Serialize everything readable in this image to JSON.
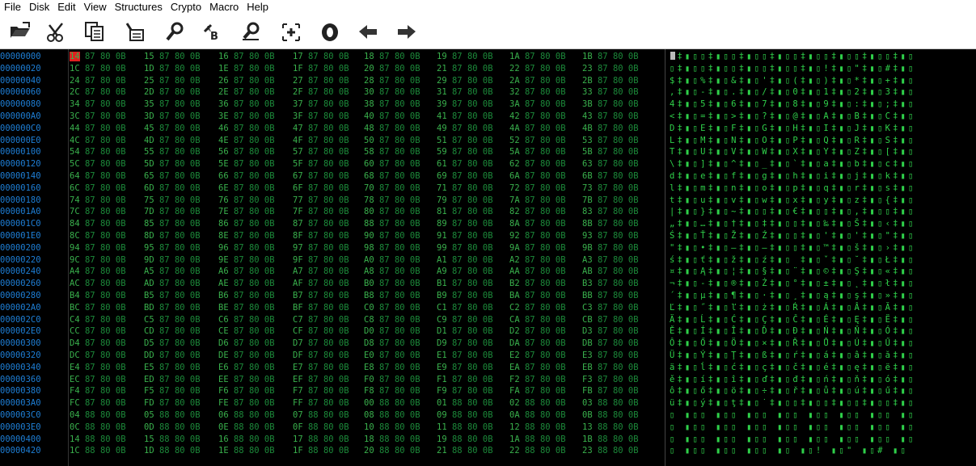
{
  "menu": [
    "File",
    "Disk",
    "Edit",
    "View",
    "Structures",
    "Crypto",
    "Macro",
    "Help"
  ],
  "toolbar": [
    {
      "name": "open-file-icon"
    },
    {
      "name": "cut-icon"
    },
    {
      "name": "copy-icon"
    },
    {
      "name": "paste-icon"
    },
    {
      "name": "search-icon"
    },
    {
      "name": "replace-icon"
    },
    {
      "name": "find-next-icon"
    },
    {
      "name": "goto-offset-icon"
    },
    {
      "name": "bookmark-icon"
    },
    {
      "name": "back-arrow-icon"
    },
    {
      "name": "forward-arrow-icon"
    }
  ],
  "hex": {
    "colors": {
      "address": "#1e7fd6",
      "hex": "#1c8a3a",
      "ascii": "#2fd04a",
      "selection": "#e02020"
    },
    "selected_byte": "14",
    "rows": [
      {
        "addr": "00000000",
        "ascii": "▯‡▮▯▯‡▮▯▯‡▮▯▯‡▮▯▯‡▮▯▯‡▮▯▯‡▮▯▯‡▮▯"
      },
      {
        "addr": "00000020",
        "ascii": "▯‡▮▯▯‡▮▯▯‡▮▯▯‡▮▯▯‡▮▯!‡▮▯\"‡▮▯#‡▮▯"
      },
      {
        "addr": "00000040",
        "ascii": "$‡▮▯%‡▮▯&‡▮▯'‡▮▯(‡▮▯)‡▮▯*‡▮▯+‡▮▯"
      },
      {
        "addr": "00000060",
        "ascii": ",‡▮▯-‡▮▯.‡▮▯/‡▮▯0‡▮▯1‡▮▯2‡▮▯3‡▮▯"
      },
      {
        "addr": "00000080",
        "ascii": "4‡▮▯5‡▮▯6‡▮▯7‡▮▯8‡▮▯9‡▮▯:‡▮▯;‡▮▯"
      },
      {
        "addr": "000000A0",
        "ascii": "<‡▮▯=‡▮▯>‡▮▯?‡▮▯@‡▮▯A‡▮▯B‡▮▯C‡▮▯"
      },
      {
        "addr": "000000C0",
        "ascii": "D‡▮▯E‡▮▯F‡▮▯G‡▮▯H‡▮▯I‡▮▯J‡▮▯K‡▮▯"
      },
      {
        "addr": "000000E0",
        "ascii": "L‡▮▯M‡▮▯N‡▮▯O‡▮▯P‡▮▯Q‡▮▯R‡▮▯S‡▮▯"
      },
      {
        "addr": "00000100",
        "ascii": "T‡▮▯U‡▮▯V‡▮▯W‡▮▯X‡▮▯Y‡▮▯Z‡▮▯[‡▮▯"
      },
      {
        "addr": "00000120",
        "ascii": "\\‡▮▯]‡▮▯^‡▮▯_‡▮▯`‡▮▯a‡▮▯b‡▮▯c‡▮▯"
      },
      {
        "addr": "00000140",
        "ascii": "d‡▮▯e‡▮▯f‡▮▯g‡▮▯h‡▮▯i‡▮▯j‡▮▯k‡▮▯"
      },
      {
        "addr": "00000160",
        "ascii": "l‡▮▯m‡▮▯n‡▮▯o‡▮▯p‡▮▯q‡▮▯r‡▮▯s‡▮▯"
      },
      {
        "addr": "00000180",
        "ascii": "t‡▮▯u‡▮▯v‡▮▯w‡▮▯x‡▮▯y‡▮▯z‡▮▯{‡▮▯"
      },
      {
        "addr": "000001A0",
        "ascii": "|‡▮▯}‡▮▯~‡▮▯▯‡▮▯€‡▮▯▯‡▮▯‚‡▮▯▯‡▮▯"
      },
      {
        "addr": "000001C0",
        "ascii": "„‡▮▯…‡▮▯†‡▮▯‡‡▮▯▯‡▮▯‰‡▮▯Š‡▮▯‹‡▮▯"
      },
      {
        "addr": "000001E0",
        "ascii": "Ś‡▮▯Ť‡▮▯Ž‡▮▯Ź‡▮▯▯‡▮▯'‡▮▯'‡▮▯\"‡▮▯"
      },
      {
        "addr": "00000200",
        "ascii": "\"‡▮▯•‡▮▯–‡▮▯—‡▮▯▯‡▮▯™‡▮▯š‡▮▯›‡▮▯"
      },
      {
        "addr": "00000220",
        "ascii": "ś‡▮▯ť‡▮▯ž‡▮▯ź‡▮▯ ‡▮▯ˇ‡▮▯˘‡▮▯Ł‡▮▯"
      },
      {
        "addr": "00000240",
        "ascii": "¤‡▮▯Ą‡▮▯¦‡▮▯§‡▮▯¨‡▮▯©‡▮▯Ş‡▮▯«‡▮▯"
      },
      {
        "addr": "00000260",
        "ascii": "¬‡▮▯-‡▮▯®‡▮▯Ż‡▮▯°‡▮▯±‡▮▯˛‡▮▯ł‡▮▯"
      },
      {
        "addr": "00000280",
        "ascii": "´‡▮▯µ‡▮▯¶‡▮▯·‡▮▯¸‡▮▯ą‡▮▯ş‡▮▯»‡▮▯"
      },
      {
        "addr": "000002A0",
        "ascii": "Ľ‡▮▯˝‡▮▯ľ‡▮▯ż‡▮▯Ŕ‡▮▯Á‡▮▯Â‡▮▯Ă‡▮▯"
      },
      {
        "addr": "000002C0",
        "ascii": "Ä‡▮▯Ĺ‡▮▯Ć‡▮▯Ç‡▮▯Č‡▮▯É‡▮▯Ę‡▮▯Ë‡▮▯"
      },
      {
        "addr": "000002E0",
        "ascii": "Ě‡▮▯Í‡▮▯Î‡▮▯Ď‡▮▯Đ‡▮▯Ń‡▮▯Ň‡▮▯Ó‡▮▯"
      },
      {
        "addr": "00000300",
        "ascii": "Ô‡▮▯Ő‡▮▯Ö‡▮▯×‡▮▯Ř‡▮▯Ů‡▮▯Ú‡▮▯Ű‡▮▯"
      },
      {
        "addr": "00000320",
        "ascii": "Ü‡▮▯Ý‡▮▯Ţ‡▮▯ß‡▮▯ŕ‡▮▯á‡▮▯â‡▮▯ă‡▮▯"
      },
      {
        "addr": "00000340",
        "ascii": "ä‡▮▯ĺ‡▮▯ć‡▮▯ç‡▮▯č‡▮▯é‡▮▯ę‡▮▯ë‡▮▯"
      },
      {
        "addr": "00000360",
        "ascii": "ě‡▮▯í‡▮▯î‡▮▯ď‡▮▯đ‡▮▯ń‡▮▯ň‡▮▯ó‡▮▯"
      },
      {
        "addr": "00000380",
        "ascii": "ô‡▮▯ő‡▮▯ö‡▮▯÷‡▮▯ř‡▮▯ů‡▮▯ú‡▮▯ű‡▮▯"
      },
      {
        "addr": "000003A0",
        "ascii": "ü‡▮▯ý‡▮▯ţ‡▮▯˙‡▮▯▯‡▮▯▯‡▮▯▯‡▮▯▯‡▮▯"
      },
      {
        "addr": "000003C0",
        "ascii": "▯ ▮▯▯ ▮▯▯ ▮▯▯ ▮▯▯ ▮▯▯ ▮▯▯ ▮▯▯ ▮▯"
      },
      {
        "addr": "000003E0",
        "ascii": "▯ ▮▯▯ ▮▯▯ ▮▯▯ ▮▯▯ ▮▯▯ ▮▯▯ ▮▯▯ ▮▯"
      },
      {
        "addr": "00000400",
        "ascii": "▯ ▮▯▯ ▮▯▯ ▮▯▯ ▮▯▯ ▮▯▯ ▮▯▯ ▮▯▯ ▮▯"
      },
      {
        "addr": "00000420",
        "ascii": "▯ ▮▯▯ ▮▯▯ ▮▯▯ ▮▯ ▮▯! ▮▯\" ▮▯# ▮▯"
      }
    ]
  }
}
